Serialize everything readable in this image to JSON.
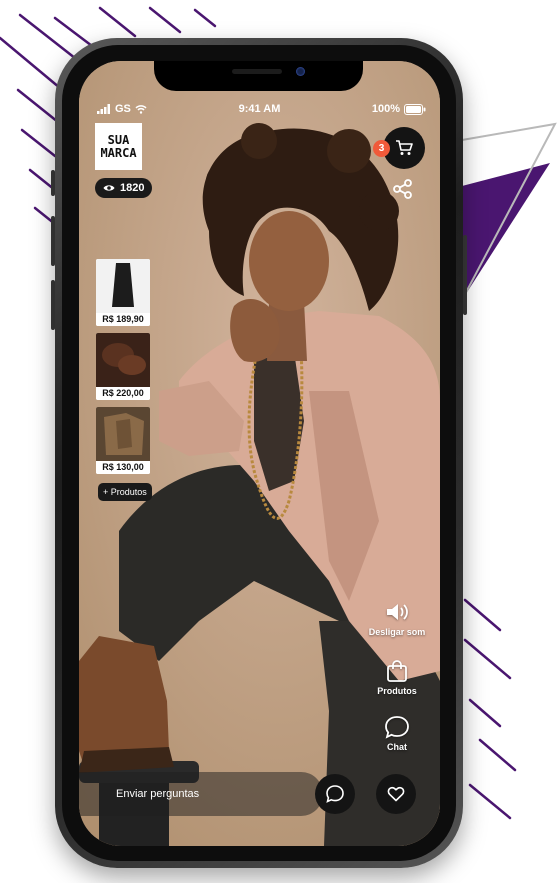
{
  "status_bar": {
    "carrier": "GS",
    "time": "9:41 AM",
    "battery": "100%"
  },
  "brand": {
    "logo_line1": "SUA",
    "logo_line2": "MARCA"
  },
  "viewers": {
    "count": "1820",
    "icon": "eye-icon"
  },
  "cart": {
    "badge_count": "3",
    "icon": "cart-icon"
  },
  "share": {
    "icon": "share-icon"
  },
  "products": [
    {
      "price": "R$ 189,90"
    },
    {
      "price": "R$ 220,00"
    },
    {
      "price": "R$ 130,00"
    }
  ],
  "more_products_label": "+ Produtos",
  "actions": {
    "sound_label": "Desligar som",
    "products_label": "Produtos",
    "chat_label": "Chat"
  },
  "ask": {
    "placeholder": "Enviar perguntas"
  },
  "colors": {
    "badge": "#f05a3a",
    "accent_purple": "#4a1670",
    "button_dark": "#141414"
  }
}
